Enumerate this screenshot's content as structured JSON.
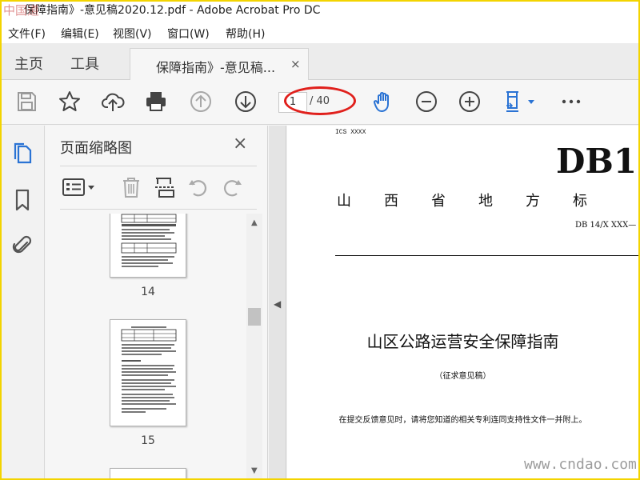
{
  "window": {
    "title": "保障指南》-意见稿2020.12.pdf - Adobe Acrobat Pro DC",
    "watermark_corner": "中国道"
  },
  "menu": [
    "文件(F)",
    "编辑(E)",
    "视图(V)",
    "窗口(W)",
    "帮助(H)"
  ],
  "tabs": {
    "home": "主页",
    "tools": "工具",
    "document": "保障指南》-意见稿...",
    "close": "×"
  },
  "toolbar": {
    "icons": [
      "save-icon",
      "bookmark-star-icon",
      "upload-cloud-icon",
      "print-icon",
      "previous-page-icon",
      "next-page-icon",
      "hand-tool-icon",
      "zoom-out-icon",
      "zoom-in-icon",
      "fit-page-icon",
      "more-icon"
    ],
    "page_current": "1",
    "page_total": "/ 40",
    "accent": "#2a73d4",
    "annotation_color": "#e0201c"
  },
  "left_rail": {
    "icons": [
      "page-thumbnails-icon",
      "bookmarks-icon",
      "attachments-icon"
    ]
  },
  "thumbnail_panel": {
    "title": "页面缩略图",
    "close": "×",
    "tools": [
      "thumbnail-options-icon",
      "delete-page-icon",
      "extract-page-icon",
      "rotate-ccw-icon",
      "rotate-cw-icon"
    ],
    "pages": [
      {
        "number": "14"
      },
      {
        "number": "15"
      }
    ]
  },
  "document": {
    "ics": "ICS XXXX",
    "db": "DB1",
    "standard_name": "山西省地方标",
    "standard_number": "DB 14/X XXX—",
    "title": "山区公路运营安全保障指南",
    "draft_label": "（征求意见稿）",
    "note": "在提交反馈意见时，请将您知道的相关专利连同支持性文件一并附上。",
    "site_watermark": "www.cndao.com"
  }
}
